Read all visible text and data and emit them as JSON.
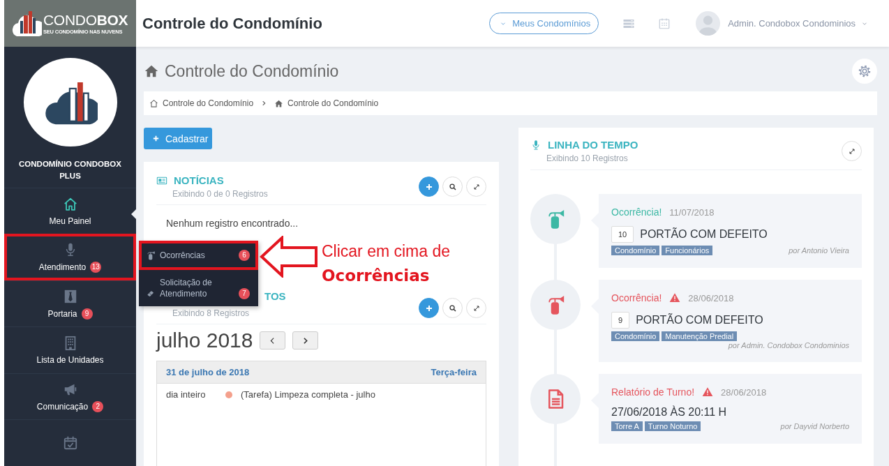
{
  "brand": {
    "name_light": "CONDO",
    "name_bold": "BOX",
    "tagline": "SEU CONDOMÍNIO NAS NUVENS"
  },
  "header": {
    "title": "Controle do Condomínio",
    "condos_button": "Meus Condomínios",
    "user": "Admin. Condobox Condominios"
  },
  "sidebar": {
    "condo_name": "CONDOMÍNIO CONDOBOX PLUS",
    "items": [
      {
        "kind": "home",
        "label": "Meu Painel",
        "selected": true,
        "highlighted": false
      },
      {
        "kind": "mic",
        "label": "Atendimento",
        "badge": "13",
        "selected": false,
        "highlighted": true
      },
      {
        "kind": "tie",
        "label": "Portaria",
        "badge": "9",
        "selected": false,
        "highlighted": false
      },
      {
        "kind": "building",
        "label": "Lista de Unidades",
        "selected": false,
        "highlighted": false
      },
      {
        "kind": "megaphone",
        "label": "Comunicação",
        "badge": "2",
        "selected": false,
        "highlighted": false
      },
      {
        "kind": "calendar",
        "selected": false,
        "highlighted": false
      }
    ]
  },
  "submenu": [
    {
      "kind": "extinguisher",
      "label": "Ocorrências",
      "badge": "6",
      "highlighted": true
    },
    {
      "kind": "ticket",
      "label": "Solicitação de Atendimento",
      "badge": "7",
      "highlighted": false
    }
  ],
  "annotation": {
    "text": "Clicar em cima de **Ocorrências**"
  },
  "page": {
    "title": "Controle do Condomínio",
    "breadcrumb": [
      "Controle do Condomínio",
      "Controle do Condomínio"
    ],
    "add_button": "Cadastrar"
  },
  "news": {
    "title": "NOTÍCIAS",
    "subtitle": "Exibindo 0 de 0 Registros",
    "empty": "Nenhum registro encontrado..."
  },
  "events": {
    "title": "TOS",
    "subtitle": "Exibindo 8 Registros",
    "month": "julho 2018",
    "day": {
      "date": "31 de julho de 2018",
      "weekday": "Terça-feira"
    },
    "entries": [
      {
        "time": "dia inteiro",
        "color": "#f4a08c",
        "text": "(Tarefa) Limpeza completa - julho"
      }
    ]
  },
  "timeline": {
    "title": "LINHA DO TEMPO",
    "subtitle": "Exibindo 10 Registros",
    "items": [
      {
        "kind": "occurrence",
        "type": "Ocorrência!",
        "alert": false,
        "date": "11/07/2018",
        "number": "10",
        "heading": "PORTÃO COM DEFEITO",
        "tags": [
          "Condomínio",
          "Funcionários"
        ],
        "author": "por Antonio Vieira"
      },
      {
        "kind": "occurrence",
        "type": "Ocorrência!",
        "alert": true,
        "date": "28/06/2018",
        "number": "9",
        "heading": "PORTÃO COM DEFEITO",
        "tags": [
          "Condomínio",
          "Manutenção Predial"
        ],
        "author": "por Admin. Condobox Condominios"
      },
      {
        "kind": "report",
        "type": "Relatório de Turno!",
        "alert": true,
        "date": "28/06/2018",
        "heading": "27/06/2018 ÀS 20:11 H",
        "tags": [
          "Torre A",
          "Turno Noturno"
        ],
        "author": "por Dayvid Norberto"
      }
    ]
  }
}
